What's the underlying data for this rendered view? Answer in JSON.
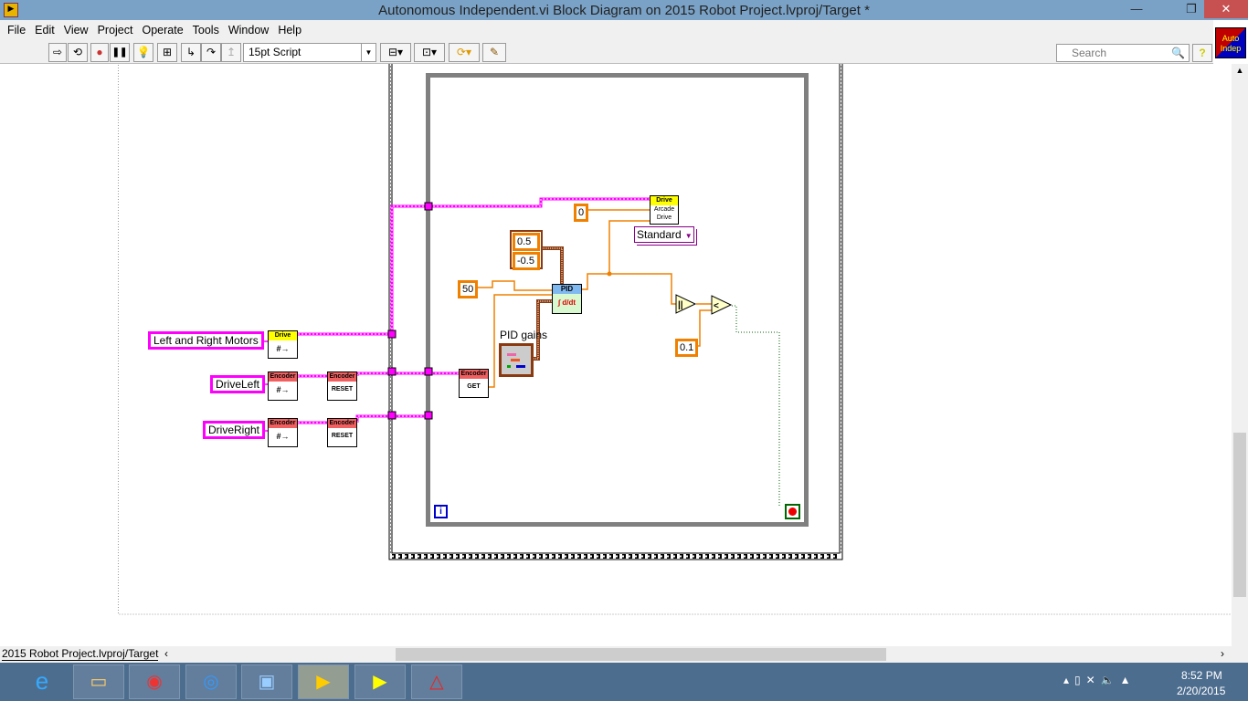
{
  "window": {
    "title": "Autonomous Independent.vi Block Diagram on 2015 Robot Project.lvproj/Target *",
    "minimize": "—",
    "restore": "❐",
    "close": "✕"
  },
  "menu": [
    "File",
    "Edit",
    "View",
    "Project",
    "Operate",
    "Tools",
    "Window",
    "Help"
  ],
  "toolbar": {
    "run": "⇨",
    "run_continuous": "⟲",
    "abort": "●",
    "pause": "❚❚",
    "highlight": "💡",
    "retain": "⊞",
    "step_into": "↳",
    "step_over": "↷",
    "step_out": "↥",
    "font": "15pt Script",
    "align": "⊟▾",
    "distribute": "⊡▾",
    "reorder": "⟳▾",
    "cleanup": "✎"
  },
  "search": {
    "placeholder": "Search"
  },
  "help": "?",
  "vi_icon": {
    "line1": "Auto",
    "line2": "Indep"
  },
  "diagram": {
    "refs": {
      "motors": "Left and Right Motors",
      "drive_left": "DriveLeft",
      "drive_right": "DriveRight"
    },
    "drive_hdr": "Drive",
    "encoder_hdr": "Encoder",
    "reset": "RESET",
    "get": "GET",
    "refnum": "#→",
    "arcade": {
      "hdr": "Drive",
      "line1": "Arcade",
      "line2": "Drive"
    },
    "enum": "Standard",
    "const_zero": "0",
    "const_50": "50",
    "const_01": "0.1",
    "range_hi": "0.5",
    "range_lo": "-0.5",
    "pid": {
      "hdr": "PID",
      "body": "∫ d/dt"
    },
    "pid_gains_label": "PID gains",
    "iteration": "i",
    "abs": "▷",
    "less": "<"
  },
  "statusbar": {
    "context": "2015 Robot Project.lvproj/Target"
  },
  "taskbar": {
    "apps": [
      "internet-explorer",
      "file-explorer",
      "chrome",
      "media",
      "control-panel",
      "labview",
      "labview-vi",
      "first-dashboard"
    ],
    "time": "8:52 PM",
    "date": "2/20/2015"
  },
  "colors": {
    "refnum_wire": "#ff00ff",
    "numeric_wire": "#f08000",
    "cluster_wire": "#8b3a0f",
    "encoder_header": "#f06060",
    "drive_header": "#ffff00",
    "pid_header": "#80b8f0"
  }
}
